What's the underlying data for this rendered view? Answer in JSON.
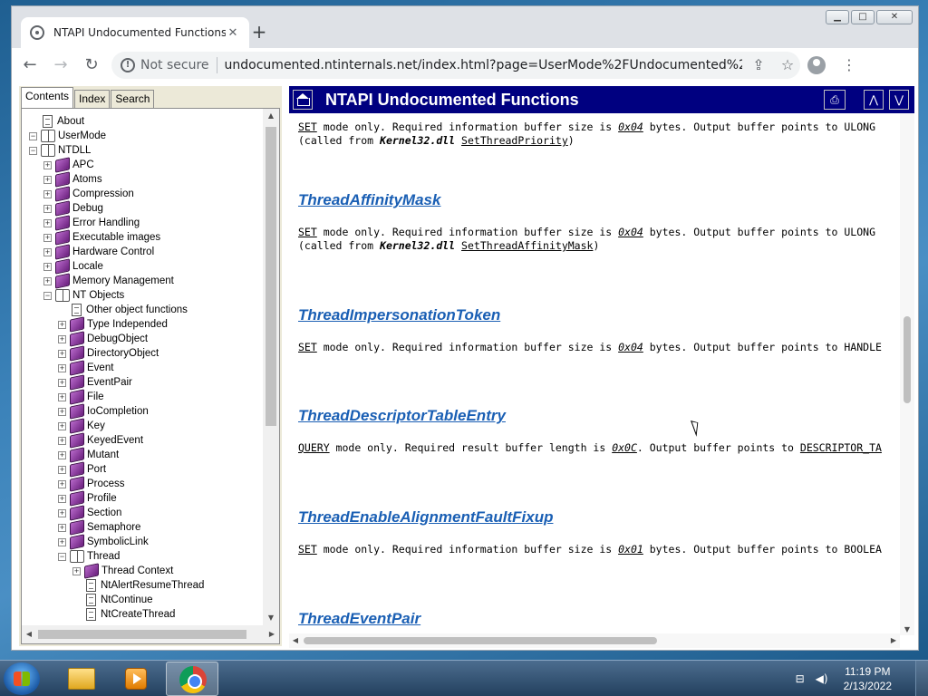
{
  "browser": {
    "tab_title": "NTAPI Undocumented Functions",
    "tab_close": "✕",
    "new_tab": "+",
    "security_label": "Not secure",
    "url": "undocumented.ntinternals.net/index.html?page=UserMode%2FUndocumented%20Functions%2FN..."
  },
  "nav": {
    "tabs": [
      "Contents",
      "Index",
      "Search"
    ]
  },
  "tree": [
    {
      "label": "About",
      "level": 0,
      "pm": "",
      "icon": "page"
    },
    {
      "label": "UserMode",
      "level": 0,
      "pm": "−",
      "icon": "open"
    },
    {
      "label": "NTDLL",
      "level": 1,
      "pm": "−",
      "icon": "open"
    },
    {
      "label": "APC",
      "level": 2,
      "pm": "+",
      "icon": "book"
    },
    {
      "label": "Atoms",
      "level": 2,
      "pm": "+",
      "icon": "book"
    },
    {
      "label": "Compression",
      "level": 2,
      "pm": "+",
      "icon": "book"
    },
    {
      "label": "Debug",
      "level": 2,
      "pm": "+",
      "icon": "book"
    },
    {
      "label": "Error Handling",
      "level": 2,
      "pm": "+",
      "icon": "book"
    },
    {
      "label": "Executable images",
      "level": 2,
      "pm": "+",
      "icon": "book"
    },
    {
      "label": "Hardware Control",
      "level": 2,
      "pm": "+",
      "icon": "book"
    },
    {
      "label": "Locale",
      "level": 2,
      "pm": "+",
      "icon": "book"
    },
    {
      "label": "Memory Management",
      "level": 2,
      "pm": "+",
      "icon": "book"
    },
    {
      "label": "NT Objects",
      "level": 2,
      "pm": "−",
      "icon": "open"
    },
    {
      "label": "Other object functions",
      "level": 3,
      "pm": "",
      "icon": "page"
    },
    {
      "label": "Type Independed",
      "level": 3,
      "pm": "+",
      "icon": "book"
    },
    {
      "label": "DebugObject",
      "level": 3,
      "pm": "+",
      "icon": "book"
    },
    {
      "label": "DirectoryObject",
      "level": 3,
      "pm": "+",
      "icon": "book"
    },
    {
      "label": "Event",
      "level": 3,
      "pm": "+",
      "icon": "book"
    },
    {
      "label": "EventPair",
      "level": 3,
      "pm": "+",
      "icon": "book"
    },
    {
      "label": "File",
      "level": 3,
      "pm": "+",
      "icon": "book"
    },
    {
      "label": "IoCompletion",
      "level": 3,
      "pm": "+",
      "icon": "book"
    },
    {
      "label": "Key",
      "level": 3,
      "pm": "+",
      "icon": "book"
    },
    {
      "label": "KeyedEvent",
      "level": 3,
      "pm": "+",
      "icon": "book"
    },
    {
      "label": "Mutant",
      "level": 3,
      "pm": "+",
      "icon": "book"
    },
    {
      "label": "Port",
      "level": 3,
      "pm": "+",
      "icon": "book"
    },
    {
      "label": "Process",
      "level": 3,
      "pm": "+",
      "icon": "book"
    },
    {
      "label": "Profile",
      "level": 3,
      "pm": "+",
      "icon": "book"
    },
    {
      "label": "Section",
      "level": 3,
      "pm": "+",
      "icon": "book"
    },
    {
      "label": "Semaphore",
      "level": 3,
      "pm": "+",
      "icon": "book"
    },
    {
      "label": "SymbolicLink",
      "level": 3,
      "pm": "+",
      "icon": "book"
    },
    {
      "label": "Thread",
      "level": 3,
      "pm": "−",
      "icon": "open"
    },
    {
      "label": "Thread Context",
      "level": 4,
      "pm": "+",
      "icon": "book"
    },
    {
      "label": "NtAlertResumeThread",
      "level": 4,
      "pm": "",
      "icon": "page"
    },
    {
      "label": "NtContinue",
      "level": 4,
      "pm": "",
      "icon": "page"
    },
    {
      "label": "NtCreateThread",
      "level": 4,
      "pm": "",
      "icon": "page"
    }
  ],
  "topic": {
    "title": "NTAPI Undocumented Functions"
  },
  "content": {
    "lead": {
      "mode": "SET",
      "text1": " mode only. Required information buffer size is ",
      "size": "0x04",
      "text2": " bytes. Output buffer points to ULONG",
      "line2_pre": "(called from ",
      "dll": "Kernel32.dll",
      "func": "SetThreadPriority",
      "line2_post": ")"
    },
    "entries": [
      {
        "title": "ThreadAffinityMask",
        "mode": "SET",
        "text1": " mode only. Required information buffer size is ",
        "size": "0x04",
        "text2": " bytes. Output buffer points to ULONG",
        "line2_pre": "(called from ",
        "dll": "Kernel32.dll",
        "func": "SetThreadAffinityMask",
        "line2_post": ")"
      },
      {
        "title": "ThreadImpersonationToken",
        "mode": "SET",
        "text1": " mode only. Required information buffer size is ",
        "size": "0x04",
        "text2": " bytes. Output buffer points to HANDLE"
      },
      {
        "title": "ThreadDescriptorTableEntry",
        "mode": "QUERY",
        "text1": " mode only. Required result buffer length is ",
        "size": "0x0C",
        "text2": ". Output buffer points to ",
        "struct": "DESCRIPTOR_TA"
      },
      {
        "title": "ThreadEnableAlignmentFaultFixup",
        "mode": "SET",
        "text1": " mode only. Required information buffer size is ",
        "size": "0x01",
        "text2": " bytes. Output buffer points to BOOLEA"
      },
      {
        "title": "ThreadEventPair"
      }
    ]
  },
  "taskbar": {
    "time": "11:19 PM",
    "date": "2/13/2022"
  }
}
